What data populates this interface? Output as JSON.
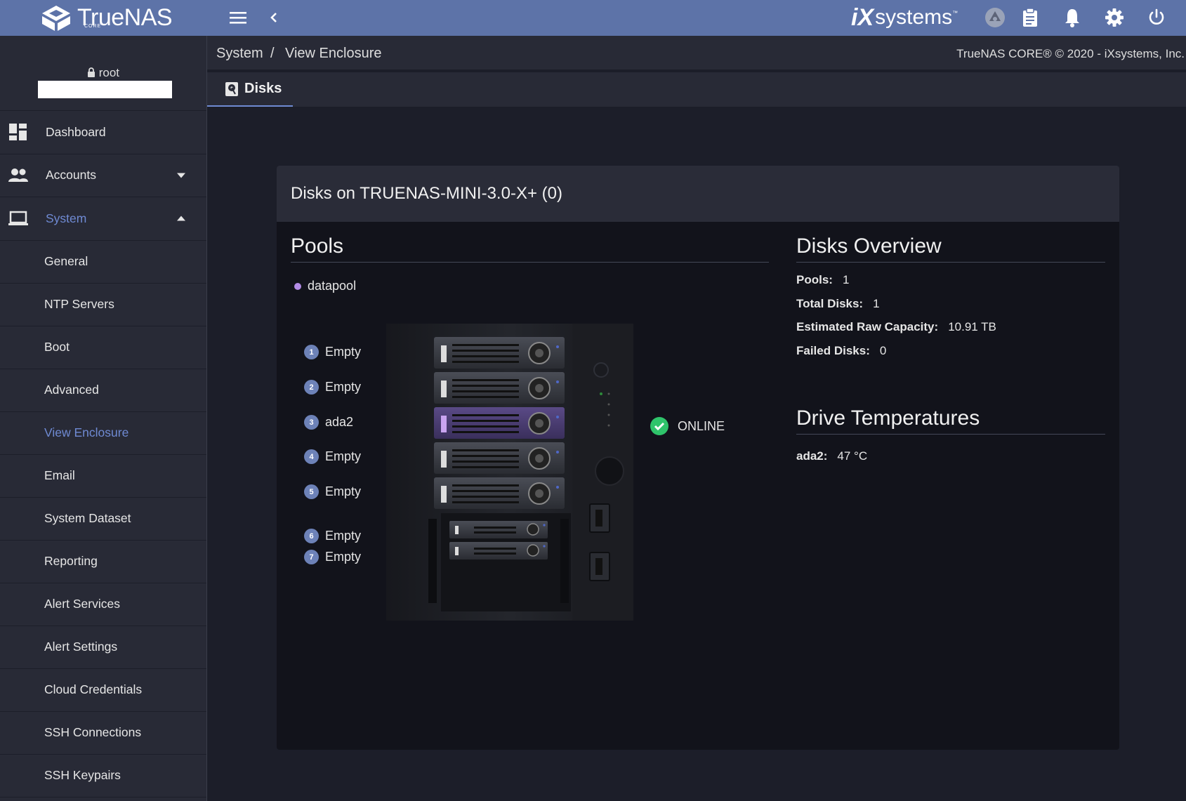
{
  "topbar": {
    "logo_text": "TrueNAS",
    "logo_sub": "CORE",
    "vendor_logo_ix": "iX",
    "vendor_logo_systems": "systems",
    "vendor_logo_tm": "™",
    "icons": [
      "menu-icon",
      "chevron-left-icon",
      "truecommand-icon",
      "clipboard-icon",
      "bell-icon",
      "gear-icon",
      "power-icon"
    ]
  },
  "sidebar": {
    "user": "root",
    "nav": [
      {
        "label": "Dashboard",
        "icon": "dashboard-icon"
      },
      {
        "label": "Accounts",
        "icon": "people-icon"
      },
      {
        "label": "System",
        "icon": "laptop-icon"
      }
    ],
    "system_sub": [
      "General",
      "NTP Servers",
      "Boot",
      "Advanced",
      "View Enclosure",
      "Email",
      "System Dataset",
      "Reporting",
      "Alert Services",
      "Alert Settings",
      "Cloud Credentials",
      "SSH Connections",
      "SSH Keypairs"
    ],
    "active_sub": "View Enclosure"
  },
  "breadcrumb": {
    "items": [
      "System",
      "View Enclosure"
    ],
    "separator": "/"
  },
  "copyright": "TrueNAS CORE® © 2020 - iXsystems, Inc.",
  "tab": {
    "label": "Disks"
  },
  "card": {
    "title": "Disks on TRUENAS-MINI-3.0-X+ (0)",
    "pools_title": "Pools",
    "pools": [
      {
        "name": "datapool",
        "color": "#b38ce6"
      }
    ],
    "slots": [
      {
        "num": "1",
        "label": "Empty"
      },
      {
        "num": "2",
        "label": "Empty"
      },
      {
        "num": "3",
        "label": "ada2"
      },
      {
        "num": "4",
        "label": "Empty"
      },
      {
        "num": "5",
        "label": "Empty"
      },
      {
        "num": "6",
        "label": "Empty"
      },
      {
        "num": "7",
        "label": "Empty"
      }
    ],
    "status": "ONLINE",
    "overview_title": "Disks Overview",
    "overview": [
      {
        "label": "Pools:",
        "value": "1"
      },
      {
        "label": "Total Disks:",
        "value": "1"
      },
      {
        "label": "Estimated Raw Capacity:",
        "value": "10.91 TB"
      },
      {
        "label": "Failed Disks:",
        "value": "0"
      }
    ],
    "temps_title": "Drive Temperatures",
    "temps": [
      {
        "label": "ada2:",
        "value": "47 °C"
      }
    ]
  },
  "colors": {
    "topbar": "#5d73a8",
    "accent": "#6f8ad3",
    "pool": "#b38ce6",
    "online": "#2fc46b"
  }
}
